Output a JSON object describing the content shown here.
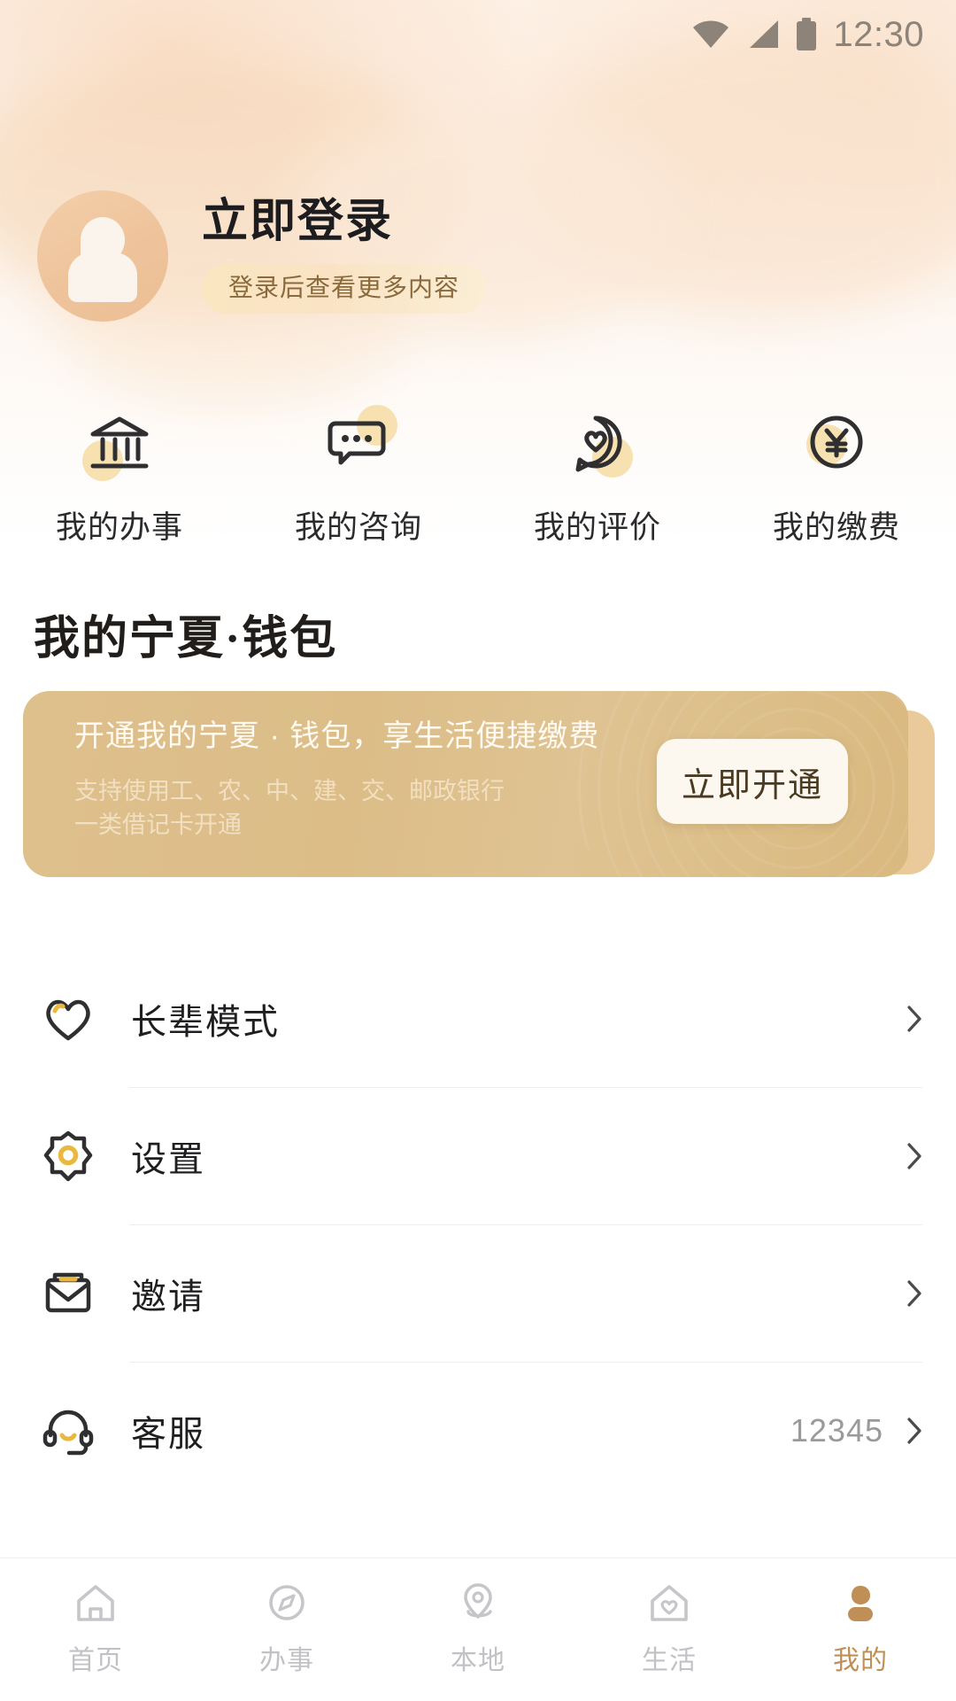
{
  "status_bar": {
    "time": "12:30",
    "icons": [
      "wifi-icon",
      "signal-icon",
      "battery-icon"
    ]
  },
  "theme": {
    "accent_gold": "#e0c08e",
    "accent_brown": "#c08f57",
    "icon_gold": "#f0c14b",
    "page_bg": "#ffffff",
    "hero_bg": "#fdf2e8"
  },
  "profile": {
    "avatar_icon": "avatar-person-icon",
    "login_title": "立即登录",
    "login_hint": "登录后查看更多内容"
  },
  "quick_actions": [
    {
      "icon": "bank-building-icon",
      "label": "我的办事"
    },
    {
      "icon": "chat-bubbles-icon",
      "label": "我的咨询"
    },
    {
      "icon": "heart-bubble-icon",
      "label": "我的评价"
    },
    {
      "icon": "yuan-circle-icon",
      "label": "我的缴费"
    }
  ],
  "wallet": {
    "section_title": "我的宁夏·钱包",
    "banner_headline": "开通我的宁夏 · 钱包，享生活便捷缴费",
    "banner_sub_line1": "支持使用工、农、中、建、交、邮政银行",
    "banner_sub_line2": "一类借记卡开通",
    "banner_button": "立即开通"
  },
  "menu": [
    {
      "icon": "heart-icon",
      "label": "长辈模式",
      "value": "",
      "chevron": "chevron-right-icon"
    },
    {
      "icon": "gear-icon",
      "label": "设置",
      "value": "",
      "chevron": "chevron-right-icon"
    },
    {
      "icon": "envelope-icon",
      "label": "邀请",
      "value": "",
      "chevron": "chevron-right-icon"
    },
    {
      "icon": "headset-icon",
      "label": "客服",
      "value": "12345",
      "chevron": "chevron-right-icon"
    }
  ],
  "tabbar": [
    {
      "icon": "home-icon",
      "label": "首页",
      "active": false
    },
    {
      "icon": "compass-icon",
      "label": "办事",
      "active": false
    },
    {
      "icon": "location-icon",
      "label": "本地",
      "active": false
    },
    {
      "icon": "house-heart-icon",
      "label": "生活",
      "active": false
    },
    {
      "icon": "person-icon",
      "label": "我的",
      "active": true
    }
  ]
}
